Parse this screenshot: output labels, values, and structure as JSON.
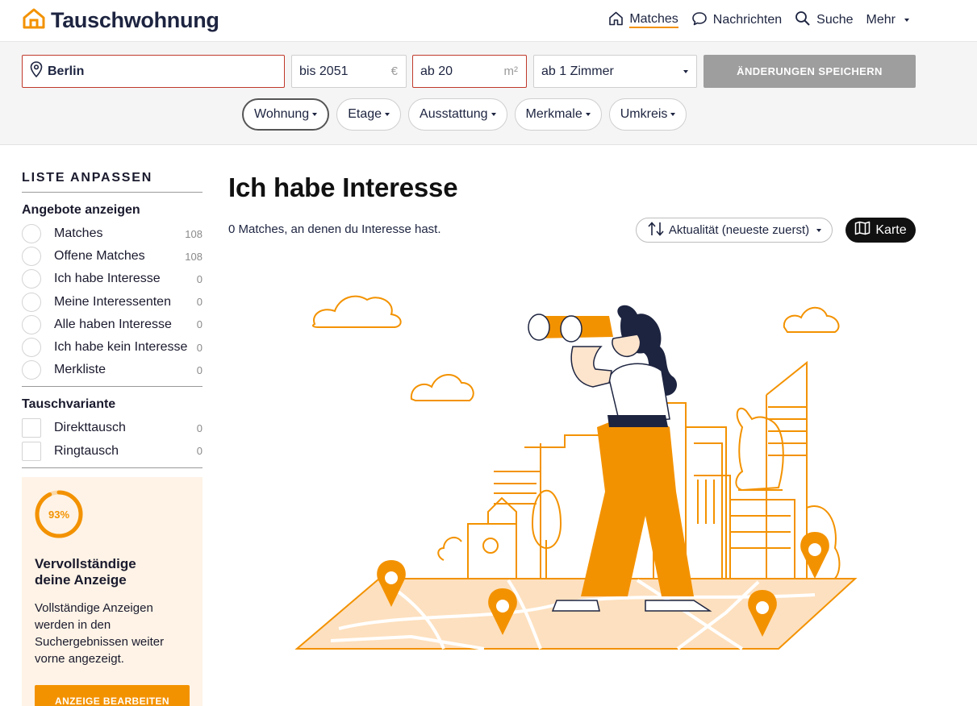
{
  "header": {
    "brand": "Tauschwohnung",
    "nav": [
      {
        "label": "Matches",
        "icon": "home-icon",
        "active": true
      },
      {
        "label": "Nachrichten",
        "icon": "chat-bubble-icon"
      },
      {
        "label": "Suche",
        "icon": "search-icon"
      },
      {
        "label": "Mehr",
        "icon": "chevron-down-icon"
      }
    ]
  },
  "search": {
    "city": "Berlin",
    "price": "bis 2051",
    "price_unit": "€",
    "area": "ab 20",
    "area_unit": "m²",
    "rooms": "ab 1 Zimmer",
    "save_label": "ÄNDERUNGEN SPEICHERN",
    "filters": [
      "Wohnung",
      "Etage",
      "Ausstattung",
      "Merkmale",
      "Umkreis"
    ]
  },
  "sidebar": {
    "title": "LISTE ANPASSEN",
    "offers_heading": "Angebote anzeigen",
    "offers": [
      {
        "label": "Matches",
        "count": "108"
      },
      {
        "label": "Offene Matches",
        "count": "108"
      },
      {
        "label": "Ich habe Interesse",
        "count": "0"
      },
      {
        "label": "Meine Interessenten",
        "count": "0"
      },
      {
        "label": "Alle haben Interesse",
        "count": "0"
      },
      {
        "label": "Ich habe kein Interesse",
        "count": "0"
      },
      {
        "label": "Merkliste",
        "count": "0"
      }
    ],
    "variant_heading": "Tauschvariante",
    "variants": [
      {
        "label": "Direkttausch",
        "count": "0"
      },
      {
        "label": "Ringtausch",
        "count": "0"
      }
    ]
  },
  "promo": {
    "progress_label": "93%",
    "progress": 0.93,
    "title": "Vervollständige deine Anzeige",
    "text": "Vollständige Anzeigen werden in den Suchergebnissen weiter vorne angezeigt.",
    "button": "ANZEIGE BEARBEITEN"
  },
  "main": {
    "title": "Ich habe Interesse",
    "subtitle": "0 Matches, an denen du Interesse hast.",
    "sort_label": "Aktualität (neueste zuerst)",
    "map_label": "Karte"
  },
  "colors": {
    "accent": "#f39200",
    "dark": "#1d2440",
    "save_disabled": "#9e9e9e"
  }
}
